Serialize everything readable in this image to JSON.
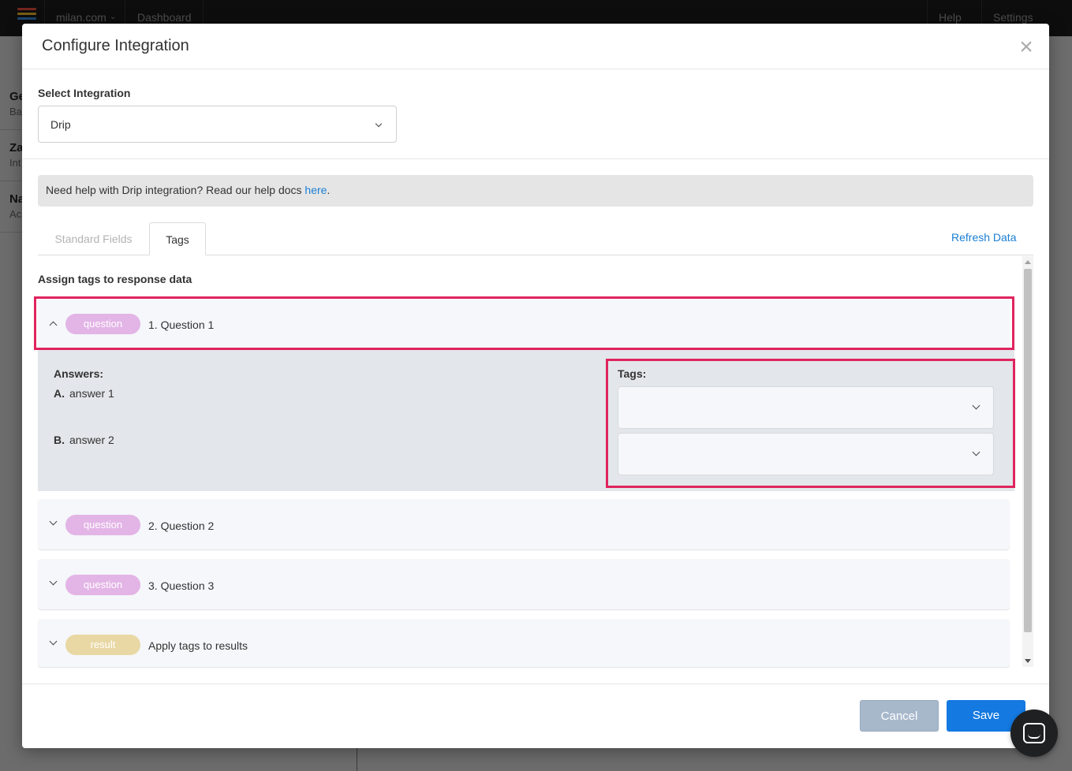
{
  "background": {
    "site": "milan.com",
    "nav_dashboard": "Dashboard",
    "nav_help": "Help",
    "nav_settings": "Settings",
    "side_rows": [
      {
        "title": "Ge",
        "sub": "Ba"
      },
      {
        "title": "Za",
        "sub": "Int"
      },
      {
        "title": "Na",
        "sub": "Ac"
      }
    ]
  },
  "modal": {
    "title": "Configure Integration",
    "close_icon": "×"
  },
  "integration": {
    "label": "Select Integration",
    "selected": "Drip"
  },
  "help": {
    "text": "Need help with Drip integration? Read our help docs ",
    "link": "here",
    "end": "."
  },
  "tabs": [
    {
      "label": "Standard Fields",
      "active": false
    },
    {
      "label": "Tags",
      "active": true
    }
  ],
  "refresh_label": "Refresh Data",
  "section_title": "Assign tags to response data",
  "questions": [
    {
      "badge": "question",
      "label": "1. Question 1",
      "expanded": true
    },
    {
      "badge": "question",
      "label": "2. Question 2",
      "expanded": false
    },
    {
      "badge": "question",
      "label": "3. Question 3",
      "expanded": false
    },
    {
      "badge": "result",
      "label": "Apply tags to results",
      "expanded": false
    }
  ],
  "expanded": {
    "answers_title": "Answers:",
    "answers": [
      {
        "letter": "A.",
        "text": "answer 1"
      },
      {
        "letter": "B.",
        "text": "answer 2"
      }
    ],
    "tags_title": "Tags:"
  },
  "footer": {
    "cancel": "Cancel",
    "save": "Save"
  },
  "colors": {
    "highlight": "#e0245e",
    "primary": "#1479e0",
    "question_badge": "#e3b4e6",
    "result_badge": "#e9d8a4"
  }
}
